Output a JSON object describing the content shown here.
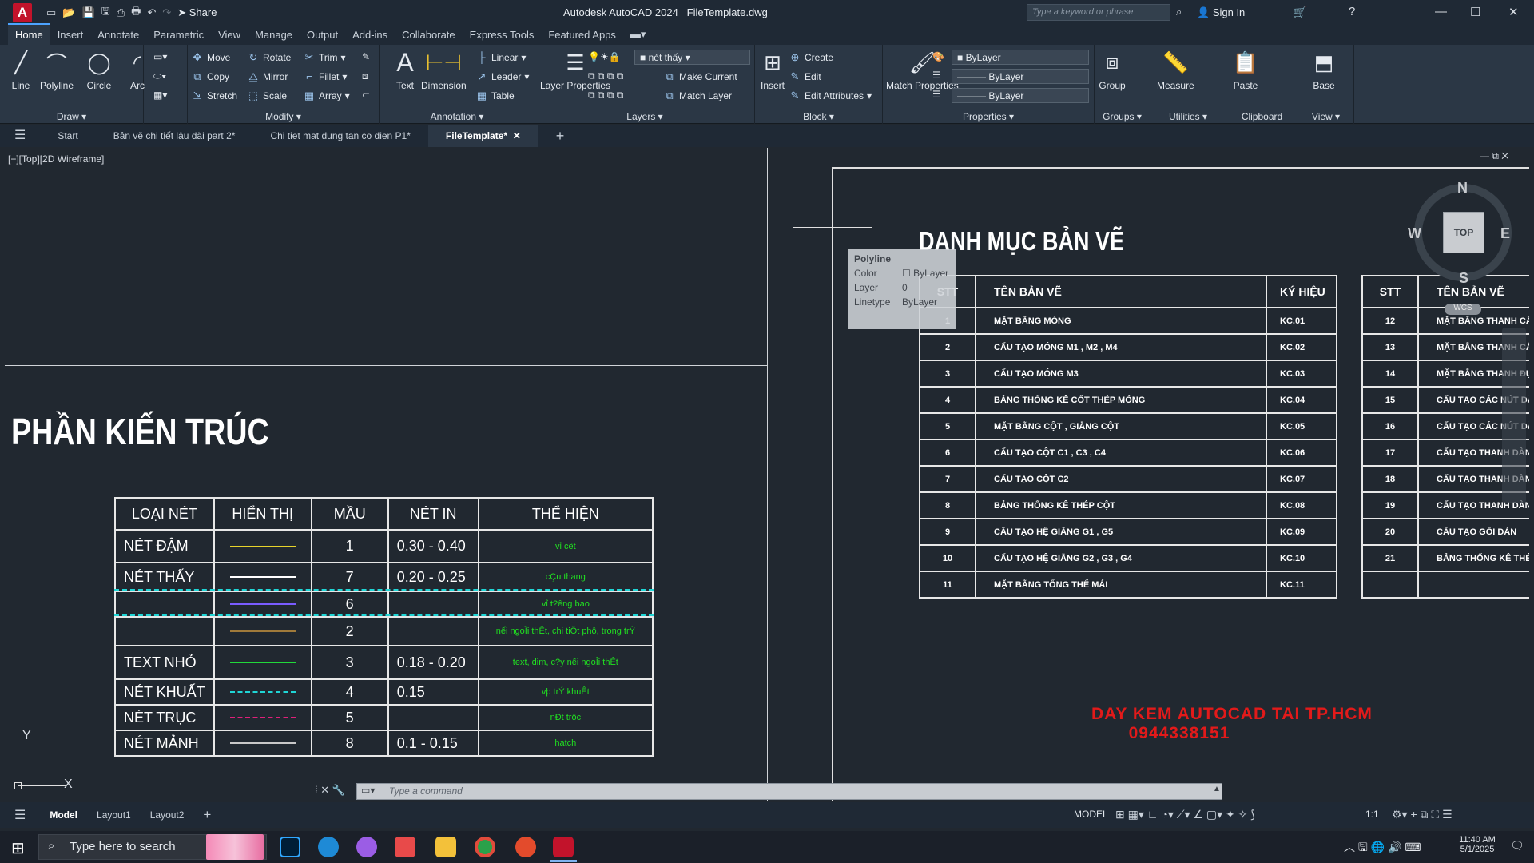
{
  "titlebar": {
    "app": "Autodesk AutoCAD 2024",
    "file": "FileTemplate.dwg",
    "share": "Share",
    "search_placeholder": "Type a keyword or phrase",
    "signin": "Sign In"
  },
  "menu_tabs": [
    "Home",
    "Insert",
    "Annotate",
    "Parametric",
    "View",
    "Manage",
    "Output",
    "Add-ins",
    "Collaborate",
    "Express Tools",
    "Featured Apps"
  ],
  "ribbon": {
    "draw": {
      "title": "Draw",
      "line": "Line",
      "polyline": "Polyline",
      "circle": "Circle",
      "arc": "Arc"
    },
    "modify": {
      "title": "Modify",
      "move": "Move",
      "rotate": "Rotate",
      "trim": "Trim",
      "copy": "Copy",
      "mirror": "Mirror",
      "fillet": "Fillet",
      "stretch": "Stretch",
      "scale": "Scale",
      "array": "Array"
    },
    "annotation": {
      "title": "Annotation",
      "text": "Text",
      "dimension": "Dimension",
      "linear": "Linear",
      "leader": "Leader",
      "table": "Table"
    },
    "layers": {
      "title": "Layers",
      "layer_properties": "Layer Properties",
      "current_layer": "nét thấy",
      "make_current": "Make Current",
      "match_layer": "Match Layer"
    },
    "block": {
      "title": "Block",
      "insert": "Insert",
      "create": "Create",
      "edit": "Edit",
      "edit_attributes": "Edit Attributes"
    },
    "properties": {
      "title": "Properties",
      "match_properties": "Match Properties",
      "color": "ByLayer",
      "lineweight": "ByLayer",
      "linetype": "ByLayer"
    },
    "groups": {
      "title": "Groups",
      "group": "Group"
    },
    "utilities": {
      "title": "Utilities",
      "measure": "Measure"
    },
    "clipboard": {
      "title": "Clipboard",
      "paste": "Paste"
    },
    "view": {
      "title": "View",
      "base": "Base"
    }
  },
  "doc_tabs": [
    "Start",
    "Bản vẽ chi tiết lâu đài part 2*",
    "Chi tiet mat dung tan co dien P1*",
    "FileTemplate*"
  ],
  "viewport_label": "[−][Top][2D Wireframe]",
  "drawing": {
    "heading_left": "PHẦN KIẾN TRÚC",
    "line_table": {
      "headers": [
        "LOẠI NÉT",
        "HIỂN THỊ",
        "MẦU",
        "NÉT IN",
        "THỂ HIỆN"
      ],
      "rows": [
        {
          "type": "NÉT ĐẬM",
          "color_no": "1",
          "print": "0.30 - 0.40",
          "usage": "vỉ cêt",
          "sample_color": "#e7d42b",
          "dash": false
        },
        {
          "type": "NÉT THẤY",
          "color_no": "7",
          "print": "0.20 - 0.25",
          "usage": "cÇu thang",
          "sample_color": "#ffffff",
          "dash": false
        },
        {
          "type": "",
          "color_no": "6",
          "print": "",
          "usage": "vỉ t?êng bao",
          "sample_color": "#7a5cff",
          "dash": false
        },
        {
          "type": "",
          "color_no": "2",
          "print": "",
          "usage": "nếi ngoÎi thÊt, chi tiÕt phô, trong trÝ",
          "sample_color": "#a07a3a",
          "dash": false
        },
        {
          "type": "TEXT NHỎ",
          "color_no": "3",
          "print": "0.18 - 0.20",
          "usage": "text, dim, c?y nếi ngoÎi thÊt",
          "sample_color": "#21d93a",
          "dash": false
        },
        {
          "type": "NÉT KHUẤT",
          "color_no": "4",
          "print": "0.15",
          "usage": "vþ trÝ khuÊt",
          "sample_color": "#1fd6d6",
          "dash": true
        },
        {
          "type": "NÉT TRỤC",
          "color_no": "5",
          "print": "",
          "usage": "nÐt trôc",
          "sample_color": "#e0207a",
          "dash": true
        },
        {
          "type": "NÉT MẢNH",
          "color_no": "8",
          "print": "0.1 - 0.15",
          "usage": "hatch",
          "sample_color": "#c8c8c8",
          "dash": false
        }
      ]
    },
    "heading_right": "DANH MỤC BẢN VẼ",
    "list_headers": [
      "STT",
      "TÊN BẢN VẼ",
      "KÝ HIỆU",
      "STT",
      "TÊN BẢN VẼ"
    ],
    "list_left": [
      {
        "stt": "1",
        "name": "MẶT BẰNG MÓNG",
        "code": "KC.01"
      },
      {
        "stt": "2",
        "name": "CẤU TẠO MÓNG M1 , M2 , M4",
        "code": "KC.02"
      },
      {
        "stt": "3",
        "name": "CẤU TẠO MÓNG M3",
        "code": "KC.03"
      },
      {
        "stt": "4",
        "name": "BẢNG THỐNG KÊ CỐT THÉP MÓNG",
        "code": "KC.04"
      },
      {
        "stt": "5",
        "name": "MẶT BẰNG CỘT , GIẰNG CỘT",
        "code": "KC.05"
      },
      {
        "stt": "6",
        "name": "CẤU TẠO CỘT C1 , C3 , C4",
        "code": "KC.06"
      },
      {
        "stt": "7",
        "name": "CẤU TẠO CỘT C2",
        "code": "KC.07"
      },
      {
        "stt": "8",
        "name": "BẢNG THỐNG KÊ THÉP CỘT",
        "code": "KC.08"
      },
      {
        "stt": "9",
        "name": "CẤU TẠO HỆ GIẰNG G1 , G5",
        "code": "KC.09"
      },
      {
        "stt": "10",
        "name": "CẤU TẠO HỆ GIẰNG G2 , G3 , G4",
        "code": "KC.10"
      },
      {
        "stt": "11",
        "name": "MẶT BẰNG TỔNG THỂ MÁI",
        "code": "KC.11"
      }
    ],
    "list_right": [
      {
        "stt": "12",
        "name": "MẶT BẰNG THANH CÁN"
      },
      {
        "stt": "13",
        "name": "MẶT BẰNG THANH CÁN"
      },
      {
        "stt": "14",
        "name": "MẶT BẰNG THANH ĐỤN"
      },
      {
        "stt": "15",
        "name": "CẤU TẠO CÁC NÚT DÀN"
      },
      {
        "stt": "16",
        "name": "CẤU TẠO CÁC NÚT DÀN"
      },
      {
        "stt": "17",
        "name": "CẤU TẠO THANH DÀN C"
      },
      {
        "stt": "18",
        "name": "CẤU TẠO THANH DÀN C"
      },
      {
        "stt": "19",
        "name": "CẤU TẠO THANH DÀN B"
      },
      {
        "stt": "20",
        "name": "CẤU TẠO GỐI DÀN"
      },
      {
        "stt": "21",
        "name": "BẢNG THỐNG KÊ THÉP"
      },
      {
        "stt": "",
        "name": ""
      }
    ],
    "promo_line1": "DAY KEM AUTOCAD TAI TP.HCM",
    "promo_line2": "0944338151"
  },
  "tooltip": {
    "title": "Polyline",
    "color_label": "Color",
    "color_value": "ByLayer",
    "layer_label": "Layer",
    "layer_value": "0",
    "linetype_label": "Linetype",
    "linetype_value": "ByLayer"
  },
  "viewcube": {
    "n": "N",
    "s": "S",
    "e": "E",
    "w": "W",
    "top": "TOP",
    "wcs": "WCS"
  },
  "ucs": {
    "x": "X",
    "y": "Y"
  },
  "command_placeholder": "Type a command",
  "layout_tabs": [
    "Model",
    "Layout1",
    "Layout2"
  ],
  "status": {
    "model": "MODEL",
    "scale": "1:1"
  },
  "taskbar": {
    "search": "Type here to search",
    "time": "11:40 AM",
    "date": "5/1/2025"
  }
}
